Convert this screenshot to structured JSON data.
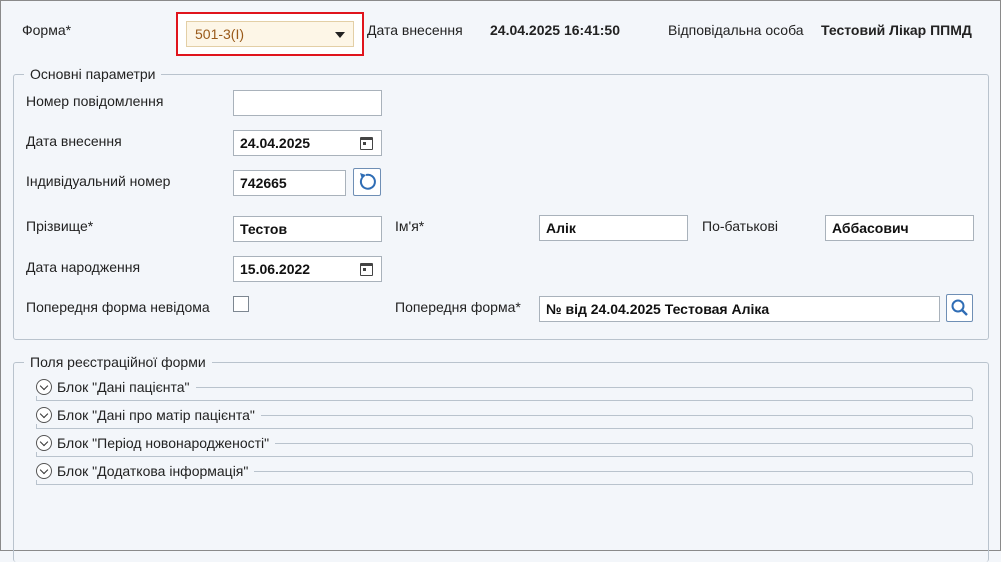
{
  "header": {
    "form_label": "Форма*",
    "form_value": "501-3(І)",
    "entry_date_label": "Дата внесення",
    "entry_date_value": "24.04.2025 16:41:50",
    "responsible_label": "Відповідальна особа",
    "responsible_value": "Тестовий Лікар ППМД"
  },
  "main_params": {
    "title": "Основні параметри",
    "message_number_label": "Номер повідомлення",
    "message_number_value": "",
    "entry_date_label": "Дата внесення",
    "entry_date_value": "24.04.2025",
    "individual_number_label": "Індивідуальний номер",
    "individual_number_value": "742665",
    "surname_label": "Прізвище*",
    "surname_value": "Тестов",
    "name_label": "Ім'я*",
    "name_value": "Алік",
    "patronymic_label": "По-батькові",
    "patronymic_value": "Аббасович",
    "birth_date_label": "Дата народження",
    "birth_date_value": "15.06.2022",
    "prev_form_unknown_label": "Попередня форма невідома",
    "prev_form_unknown_checked": false,
    "prev_form_label": "Попередня форма*",
    "prev_form_value": "№  від 24.04.2025 Тестовая Аліка"
  },
  "registration_fields": {
    "title": "Поля реєстраційної форми",
    "blocks": [
      {
        "label": "Блок \"Дані пацієнта\""
      },
      {
        "label": "Блок \"Дані про матір пацієнта\""
      },
      {
        "label": "Блок \"Період новонародженості\""
      },
      {
        "label": "Блок \"Додаткова інформація\""
      }
    ]
  },
  "colors": {
    "highlight_border": "#e0141c",
    "select_bg": "#fdf6e7",
    "accent_blue": "#2f6db5"
  },
  "icons": [
    "chevron-down-icon",
    "calendar-icon",
    "refresh-icon",
    "search-icon",
    "expand-circle-icon"
  ]
}
